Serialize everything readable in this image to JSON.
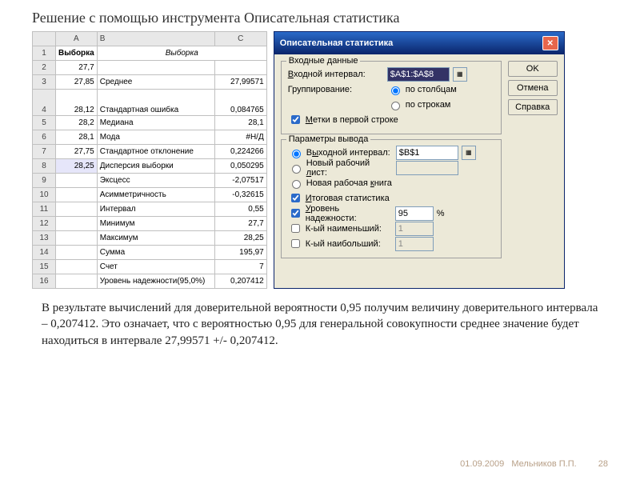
{
  "page": {
    "title": "Решение с помощью инструмента Описательная статистика",
    "footer_date": "01.09.2009",
    "footer_author": "Мельников П.П.",
    "footer_page": "28",
    "result_text": "В результате вычислений для доверительной вероятности 0,95 получим величину доверительного интервала – 0,207412. Это означает, что с вероятностью 0,95 для генеральной совокупности среднее значение будет находиться в интервале 27,99571 +/- 0,207412."
  },
  "sheet": {
    "cols": [
      "A",
      "B",
      "C"
    ],
    "header": {
      "A": "Выборка",
      "B": "Выборка"
    },
    "rows": [
      {
        "n": "2",
        "A": "27,7",
        "B": "",
        "C": ""
      },
      {
        "n": "3",
        "A": "27,85",
        "B": "Среднее",
        "C": "27,99571"
      },
      {
        "n": "4",
        "A": "28,12",
        "B": "Стандартная ошибка",
        "C": "0,084765"
      },
      {
        "n": "5",
        "A": "28,2",
        "B": "Медиана",
        "C": "28,1"
      },
      {
        "n": "6",
        "A": "28,1",
        "B": "Мода",
        "C": "#Н/Д"
      },
      {
        "n": "7",
        "A": "27,75",
        "B": "Стандартное отклонение",
        "C": "0,224266"
      },
      {
        "n": "8",
        "A": "28,25",
        "B": "Дисперсия выборки",
        "C": "0,050295"
      },
      {
        "n": "9",
        "A": "",
        "B": "Эксцесс",
        "C": "-2,07517"
      },
      {
        "n": "10",
        "A": "",
        "B": "Асимметричность",
        "C": "-0,32615"
      },
      {
        "n": "11",
        "A": "",
        "B": "Интервал",
        "C": "0,55"
      },
      {
        "n": "12",
        "A": "",
        "B": "Минимум",
        "C": "27,7"
      },
      {
        "n": "13",
        "A": "",
        "B": "Максимум",
        "C": "28,25"
      },
      {
        "n": "14",
        "A": "",
        "B": "Сумма",
        "C": "195,97"
      },
      {
        "n": "15",
        "A": "",
        "B": "Счет",
        "C": "7"
      },
      {
        "n": "16",
        "A": "",
        "B": "Уровень надежности(95,0%)",
        "C": "0,207412"
      }
    ]
  },
  "dialog": {
    "title": "Описательная статистика",
    "buttons": {
      "ok": "OK",
      "cancel": "Отмена",
      "help": "Справка"
    },
    "group_input_legend": "Входные данные",
    "label_input_range": "Входной интервал:",
    "value_input_range": "$A$1:$A$8",
    "label_grouping": "Группирование:",
    "radio_by_columns": "по столбцам",
    "radio_by_rows": "по строкам",
    "check_labels_first_row": "Метки в первой строке",
    "group_output_legend": "Параметры вывода",
    "radio_output_range": "Выходной интервал:",
    "value_output_range": "$B$1",
    "radio_new_sheet": "Новый рабочий лист:",
    "radio_new_book": "Новая рабочая книга",
    "check_summary": "Итоговая статистика",
    "check_confidence": "Уровень надежности:",
    "value_confidence": "95",
    "pct": "%",
    "check_kth_smallest": "К-ый наименьший:",
    "value_kth_smallest": "1",
    "check_kth_largest": "К-ый наибольший:",
    "value_kth_largest": "1"
  }
}
